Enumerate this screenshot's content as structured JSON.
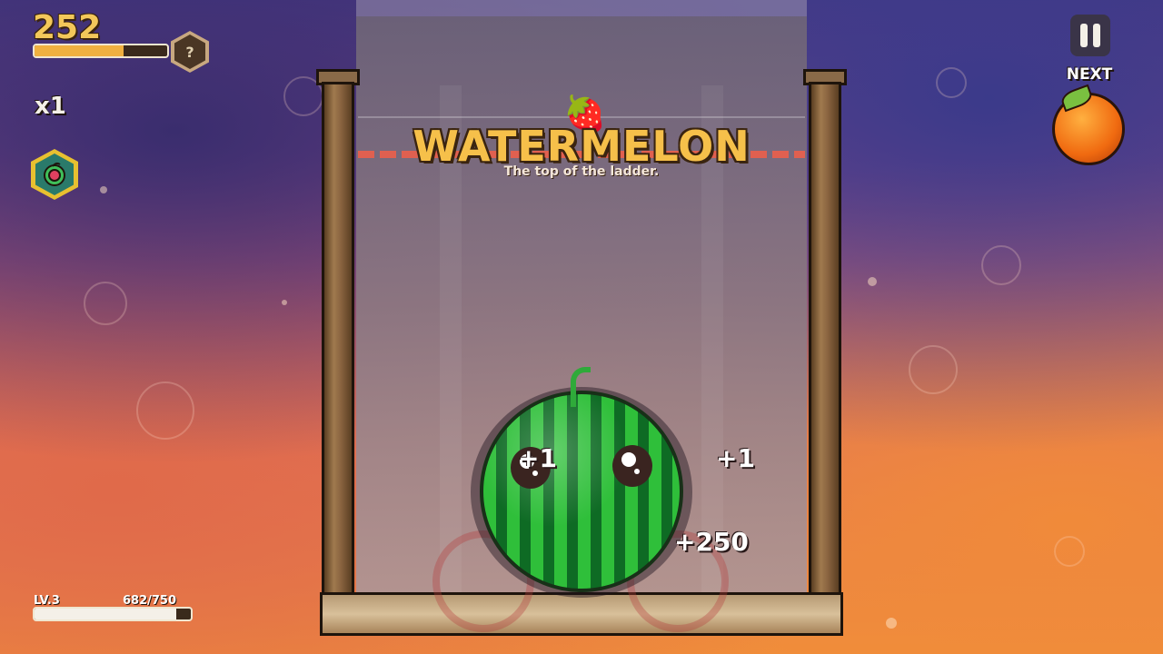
{
  "hud": {
    "score": "252",
    "score_progress": 0.67,
    "mystery_label": "?",
    "multiplier": "x1",
    "pause_icon": "pause-icon",
    "powerup_icon": "fruit-powerup-icon"
  },
  "next": {
    "label": "NEXT",
    "fruit": "orange"
  },
  "level": {
    "label": "LV.3",
    "xp": "682/750",
    "progress": 0.909
  },
  "banner": {
    "icon": "🍓",
    "title": "WATERMELON",
    "subtitle": "The top of the ladder."
  },
  "floating_scores": [
    "+1",
    "+1",
    "+250"
  ],
  "colors": {
    "score_gold": "#f3c85a",
    "danger_line": "#e06050",
    "melon_light": "#2fbf3a",
    "melon_dark": "#0e6b24"
  }
}
